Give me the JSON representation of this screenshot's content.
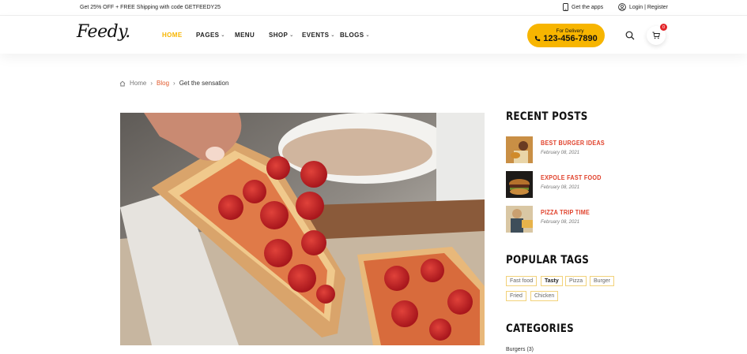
{
  "topbar": {
    "promo": "Get 25% OFF + FREE Shipping with code GETFEEDY25",
    "apps": "Get the apps",
    "login": "Login | Register"
  },
  "header": {
    "logo": "Feedy.",
    "nav": [
      {
        "label": "HOME",
        "active": true,
        "caret": false
      },
      {
        "label": "PAGES",
        "active": false,
        "caret": true
      },
      {
        "label": "MENU",
        "active": false,
        "caret": false
      },
      {
        "label": "SHOP",
        "active": false,
        "caret": true
      },
      {
        "label": "EVENTS",
        "active": false,
        "caret": true
      },
      {
        "label": "BLOGS",
        "active": false,
        "caret": true
      }
    ],
    "delivery_label": "For Delivery",
    "delivery_phone": "123-456-7890",
    "cart_count": "0"
  },
  "breadcrumb": {
    "home": "Home",
    "blog": "Blog",
    "current": "Get the sensation"
  },
  "sidebar": {
    "recent_title": "RECENT POSTS",
    "posts": [
      {
        "title": "BEST BURGER IDEAS",
        "date": "February 08, 2021"
      },
      {
        "title": "EXPOLE FAST FOOD",
        "date": "February 08, 2021"
      },
      {
        "title": "PIZZA TRIP TIME",
        "date": "February 08, 2021"
      }
    ],
    "tags_title": "POPULAR TAGS",
    "tags": [
      "Fast food",
      "Tasty",
      "Pizza",
      "Burger",
      "Fried",
      "Chicken"
    ],
    "categories_title": "CATEGORIES",
    "categories": [
      {
        "label": "Burgers (3)"
      }
    ]
  },
  "colors": {
    "accent": "#f7b500",
    "post_title": "#e0402a",
    "badge": "#e3262a"
  }
}
